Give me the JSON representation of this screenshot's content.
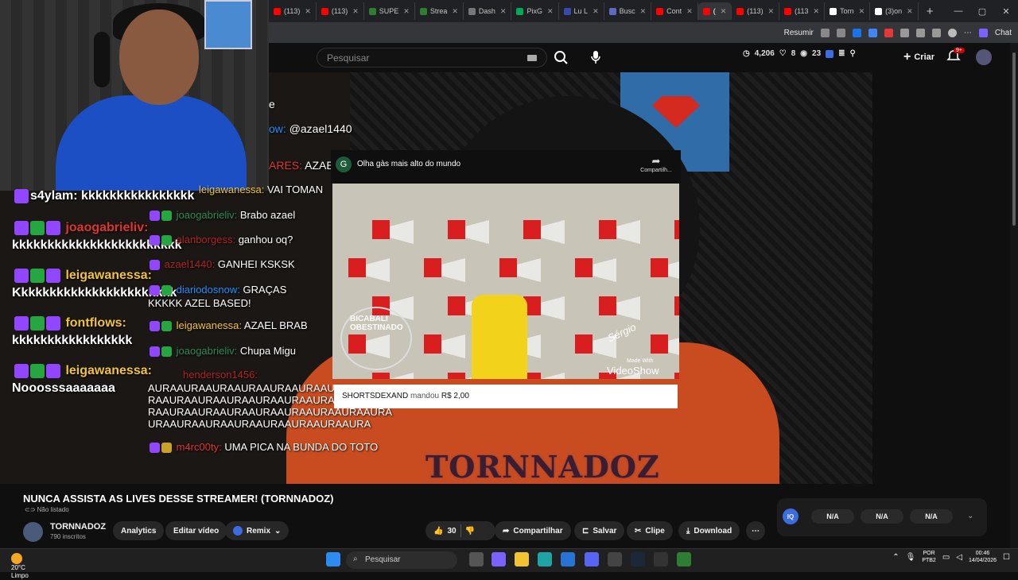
{
  "browser": {
    "tabs": [
      {
        "label": "(113)",
        "color": "#ff0000"
      },
      {
        "label": "(113)",
        "color": "#ff0000"
      },
      {
        "label": "SUPE",
        "color": "#2e7d32"
      },
      {
        "label": "Strea",
        "color": "#2e7d32"
      },
      {
        "label": "Dash",
        "color": "#777777"
      },
      {
        "label": "PixG",
        "color": "#00a859"
      },
      {
        "label": "Lu L",
        "color": "#3949ab"
      },
      {
        "label": "Busc",
        "color": "#5c6bc0"
      },
      {
        "label": "Cont",
        "color": "#ff0000"
      },
      {
        "label": "(",
        "color": "#ff0000"
      },
      {
        "label": "(113)",
        "color": "#ff0000"
      },
      {
        "label": "(113",
        "color": "#ff0000"
      },
      {
        "label": "Torn",
        "color": "#ffffff"
      },
      {
        "label": "(3)on",
        "color": "#ffffff"
      }
    ],
    "active_tab_index": 9,
    "toolbar": {
      "resumir": "Resumir",
      "chat": "Chat"
    }
  },
  "youtube": {
    "search_placeholder": "Pesquisar",
    "stats": {
      "viewers": "4,206",
      "likes": "8",
      "watching": "23"
    },
    "create_label": "Criar",
    "notif_badge": "9+"
  },
  "webcam_chat": [
    {
      "user": "s4ylam:",
      "msg": "kkkkkkkkkkkkkkkk",
      "ucolor": "#ffffff"
    },
    {
      "user": "joaogabrieliv:",
      "msg": "kkkkkkkkkkkkkkkkkkkkkkkk",
      "ucolor": "#e0342d"
    },
    {
      "user": "leigawanessa:",
      "msg": "Kkkkkkkkkkkkkkkkkkkkkkk",
      "ucolor": "#f4c430"
    },
    {
      "user": "fontflows:",
      "msg": "kkkkkkkkkkkkkkkkk",
      "ucolor": "#f4c430"
    },
    {
      "user": "leigawanessa:",
      "msg": "Nooosssaaaaaaa",
      "ucolor": "#f4c430"
    }
  ],
  "stream_chat": [
    {
      "user": "",
      "msg": "e"
    },
    {
      "user": "ow:",
      "msg": "@azael1440"
    },
    {
      "user": "ARES:",
      "msg": "AZAEL"
    },
    {
      "user": "leigawanessa:",
      "msg": "VAI TOMAN"
    },
    {
      "user": "joaogabrieliv:",
      "msg": "Brabo azael"
    },
    {
      "user": "alanborgess:",
      "msg": "ganhou oq?"
    },
    {
      "user": "azael1440:",
      "msg": "GANHEI KSKSK"
    },
    {
      "user": "diariodosnow:",
      "msg": "GRAÇAS"
    },
    {
      "user": "",
      "msg": "KKKKK AZEL BASED!"
    },
    {
      "user": "leigawanessa:",
      "msg": "AZAEL BRAB"
    },
    {
      "user": "joaogabrieliv:",
      "msg": "Chupa Migu"
    },
    {
      "user": "henderson1456:",
      "msg": ""
    },
    {
      "user": "",
      "msg": "AURAAURAAURAAURAAURAAURAAURAAU"
    },
    {
      "user": "",
      "msg": "RAAURAAURAAURAAURAAURAAURAAURAAURA"
    },
    {
      "user": "",
      "msg": "RAAURAAURAAURAAURAAURAAURAAURAAURA"
    },
    {
      "user": "",
      "msg": "URAAURAAURAAURAAURAAURAAURAAURA"
    },
    {
      "user": "m4rc00ty:",
      "msg": "UMA PICA NA BUNDA DO TOTO"
    }
  ],
  "short": {
    "channel_initial": "G",
    "title": "Olha gàs mais alto do mundo",
    "share": "Compartilh...",
    "wm_left": "BICABALI OBESTINADO",
    "wm_right": "Sérgio",
    "wm_made": "Made With",
    "wm_vs": "VideoShow"
  },
  "donation": {
    "user": "SHORTSDEXAND",
    "action": "mandou",
    "amount": "R$ 2,00"
  },
  "overlay_logo": "TORNNADOZ",
  "video": {
    "title": "NUNCA ASSISTA AS LIVES DESSE STREAMER! (TORNNADOZ)",
    "status": "Não listado",
    "channel": "TORNNADOZ",
    "subs": "790 inscritos",
    "buttons": {
      "analytics": "Analytics",
      "edit": "Editar vídeo",
      "remix": "Remix",
      "likes": "30",
      "share": "Compartilhar",
      "save": "Salvar",
      "clip": "Clipe",
      "download": "Download"
    }
  },
  "iq": {
    "label": "IQ",
    "values": [
      "N/A",
      "N/A",
      "N/A"
    ]
  },
  "taskbar": {
    "weather_temp": "20°C",
    "weather_desc": "Limpo",
    "search": "Pesquisar",
    "lang": "POR",
    "layout": "PTB2",
    "time": "00:46",
    "date": "14/04/2026"
  }
}
